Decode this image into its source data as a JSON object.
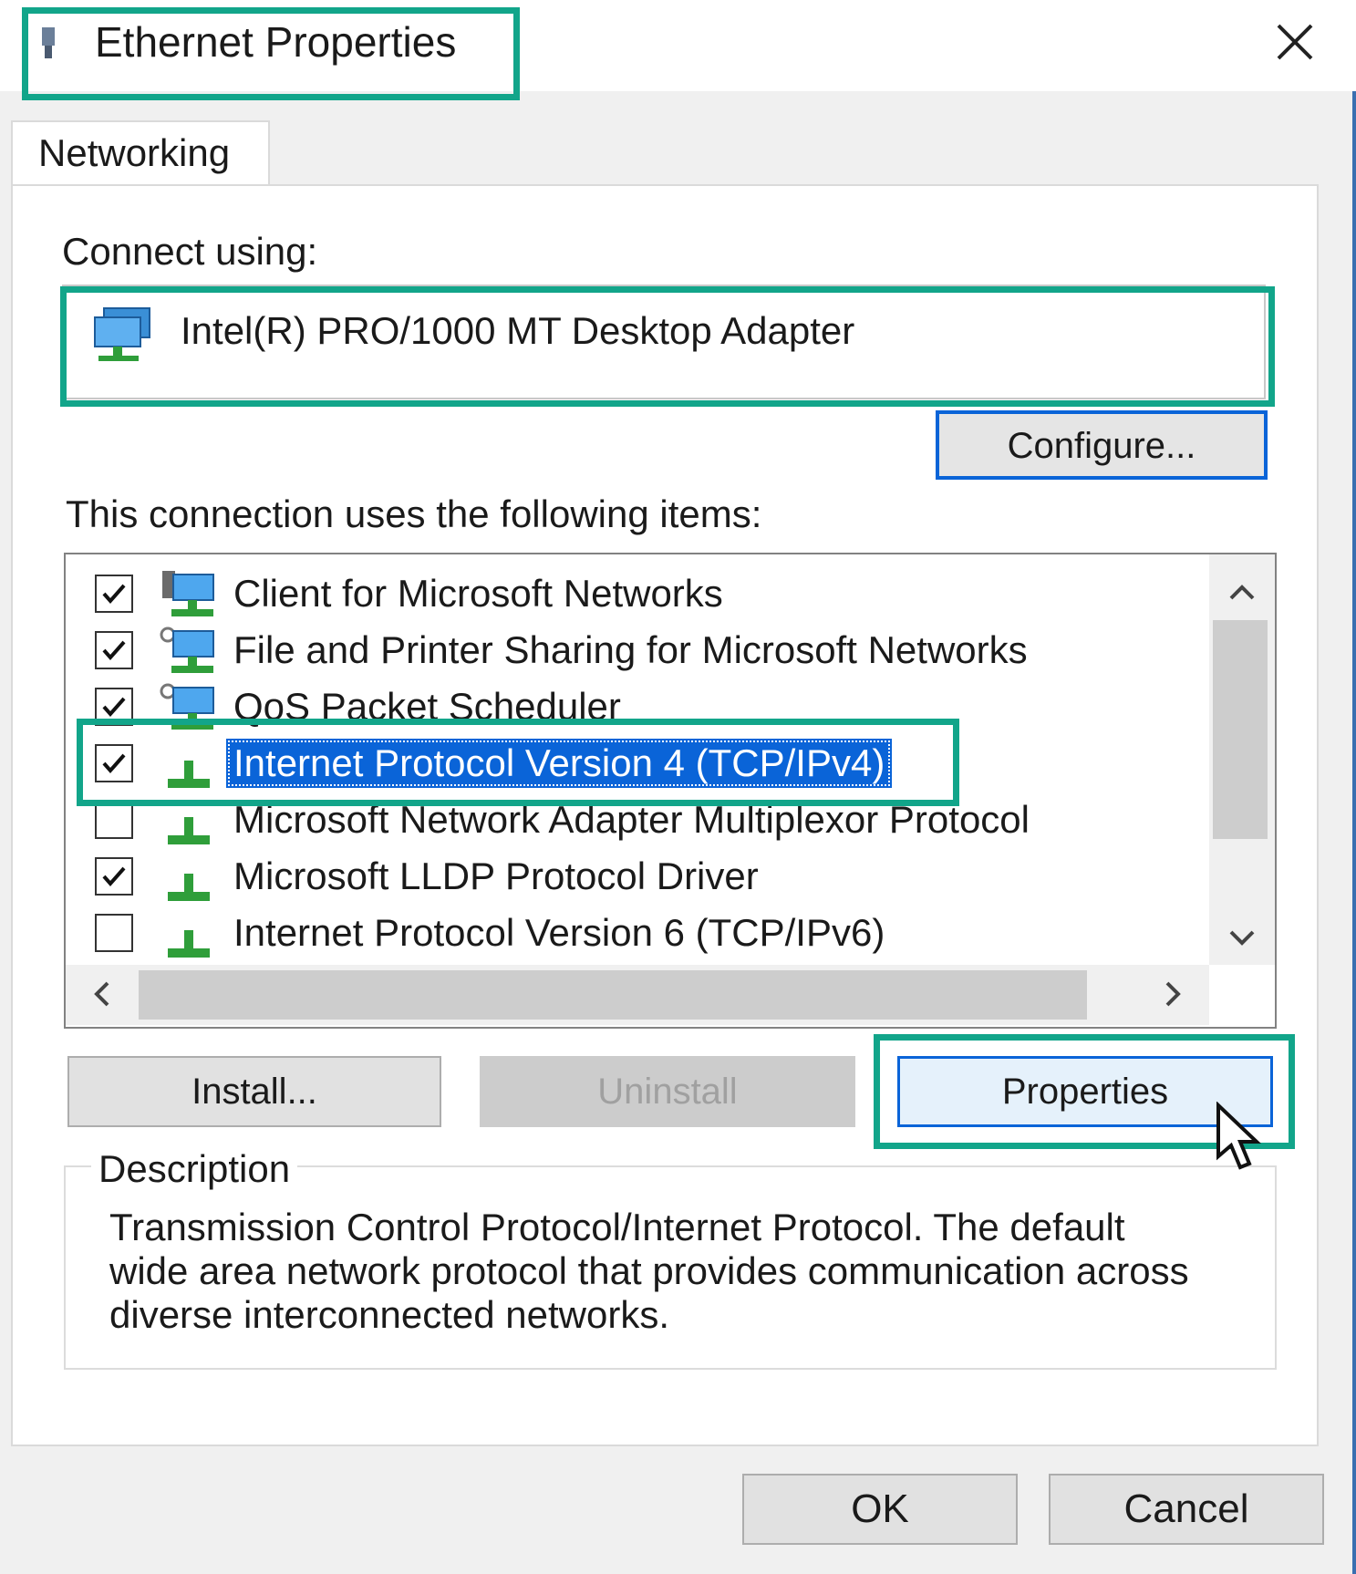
{
  "window": {
    "title": "Ethernet Properties",
    "close_glyph": "✕"
  },
  "tabs": [
    {
      "label": "Networking",
      "active": true
    }
  ],
  "connect": {
    "label": "Connect using:",
    "adapter_name": "Intel(R) PRO/1000 MT Desktop Adapter",
    "adapter_icon": "network-adapter-icon",
    "configure_label": "Configure..."
  },
  "items": {
    "label": "This connection uses the following items:",
    "list": [
      {
        "label": "Client for Microsoft Networks",
        "checked": true,
        "icon": "network-client-icon",
        "selected": false
      },
      {
        "label": "File and Printer Sharing for Microsoft Networks",
        "checked": true,
        "icon": "network-service-icon",
        "selected": false
      },
      {
        "label": "QoS Packet Scheduler",
        "checked": true,
        "icon": "network-service-icon",
        "selected": false
      },
      {
        "label": "Internet Protocol Version 4 (TCP/IPv4)",
        "checked": true,
        "icon": "protocol-icon",
        "selected": true
      },
      {
        "label": "Microsoft Network Adapter Multiplexor Protocol",
        "checked": false,
        "icon": "protocol-icon",
        "selected": false
      },
      {
        "label": "Microsoft LLDP Protocol Driver",
        "checked": true,
        "icon": "protocol-icon",
        "selected": false
      },
      {
        "label": "Internet Protocol Version 6 (TCP/IPv6)",
        "checked": false,
        "icon": "protocol-icon",
        "selected": false
      }
    ]
  },
  "buttons": {
    "install": "Install...",
    "uninstall": "Uninstall",
    "properties": "Properties",
    "ok": "OK",
    "cancel": "Cancel"
  },
  "description": {
    "legend": "Description",
    "text": "Transmission Control Protocol/Internet Protocol. The default wide area network protocol that provides communication across diverse interconnected networks."
  },
  "colors": {
    "highlight_box": "#12a58a",
    "selection": "#0a64d8",
    "focus_border": "#0a64d8",
    "dialog_bg": "#f0f0f0"
  }
}
